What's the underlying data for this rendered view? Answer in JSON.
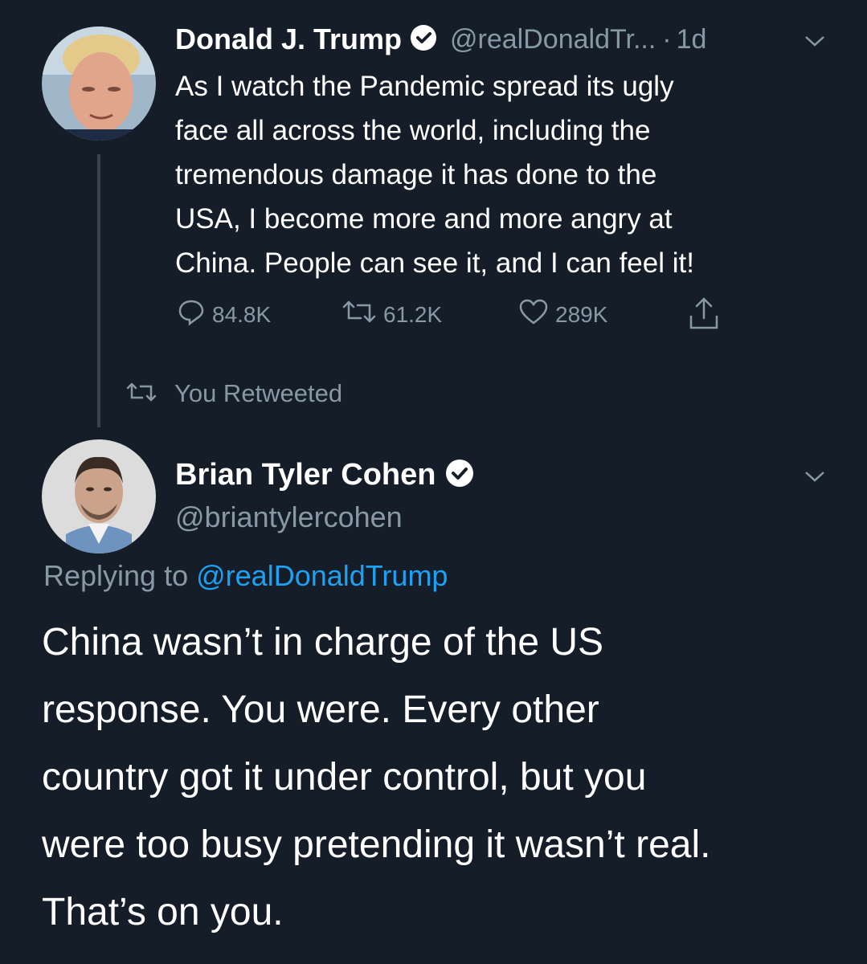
{
  "tweet": {
    "author_name": "Donald J. Trump",
    "handle": "@realDonaldTr...",
    "separator": "·",
    "time": "1d",
    "text_lines": [
      "As I watch the Pandemic spread its ugly",
      "face all across the world, including the",
      "tremendous damage it has done to the",
      "USA, I become more and more angry at",
      "China. People can see it, and I can feel it!"
    ],
    "reply_count": "84.8K",
    "retweet_count": "61.2K",
    "like_count": "289K"
  },
  "retweet_status": "You Retweeted",
  "reply": {
    "author_name": "Brian Tyler Cohen",
    "handle": "@briantylercohen",
    "replying_prefix": "Replying to",
    "replying_to": "@realDonaldTrump",
    "text_lines": [
      "China wasn’t in charge of the US",
      "response. You were. Every other",
      "country got it under control, but you",
      "were too busy pretending it wasn’t real.",
      "That’s on you."
    ]
  },
  "colors": {
    "background": "#151d28",
    "muted": "#8899a6",
    "link": "#1da1f2",
    "thread_line": "#38444d"
  }
}
